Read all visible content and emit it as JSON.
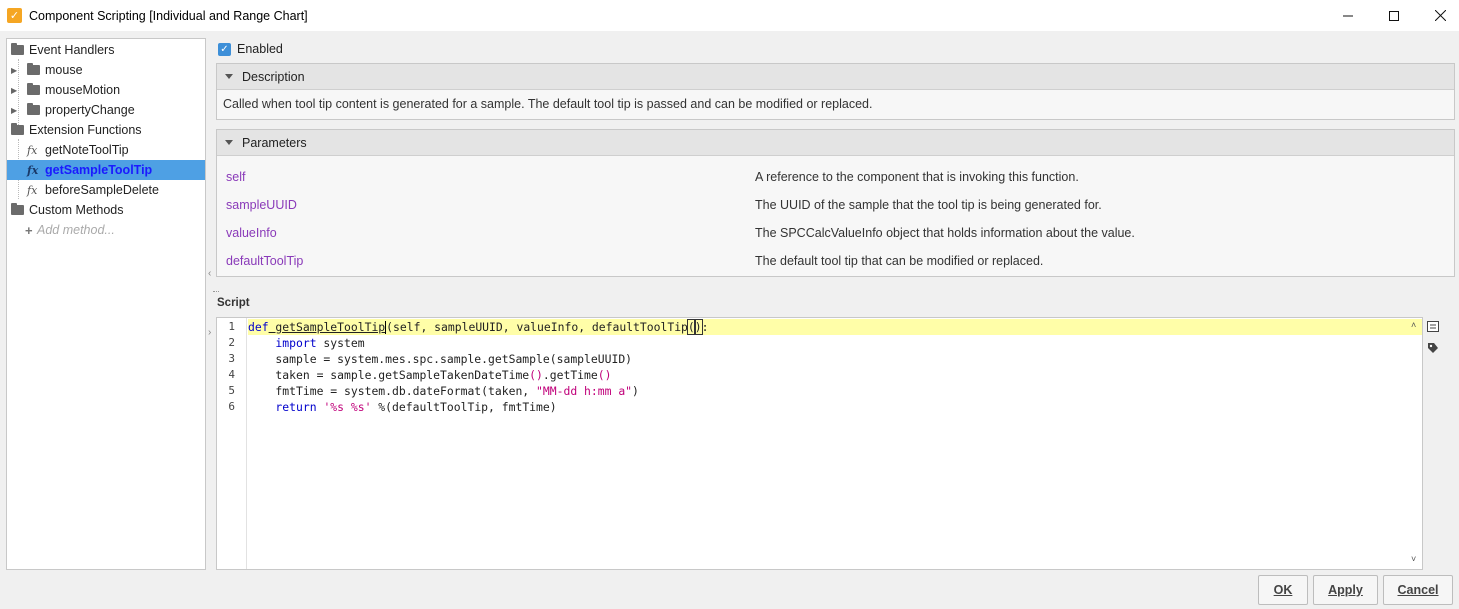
{
  "window": {
    "title": "Component Scripting [Individual and Range Chart]",
    "controls": [
      "minimize-icon",
      "maximize-icon",
      "close-icon"
    ]
  },
  "tree": {
    "event_handlers_label": "Event Handlers",
    "event_handlers": [
      "mouse",
      "mouseMotion",
      "propertyChange"
    ],
    "extension_functions_label": "Extension Functions",
    "extension_functions": [
      "getNoteToolTip",
      "getSampleToolTip",
      "beforeSampleDelete"
    ],
    "selected": "getSampleToolTip",
    "custom_methods_label": "Custom Methods",
    "add_method_label": "Add method..."
  },
  "enabled": {
    "label": "Enabled",
    "checked": true
  },
  "description": {
    "header": "Description",
    "text": "Called when tool tip content is generated for a sample. The default tool tip is passed and can be modified or replaced."
  },
  "parameters": {
    "header": "Parameters",
    "rows": [
      {
        "name": "self",
        "desc": "A reference to the component that is invoking this function."
      },
      {
        "name": "sampleUUID",
        "desc": "The UUID of the sample that the tool tip is being generated for."
      },
      {
        "name": "valueInfo",
        "desc": "The SPCCalcValueInfo object that holds information about the value."
      },
      {
        "name": "defaultToolTip",
        "desc": "The default tool tip that can be modified or replaced."
      }
    ]
  },
  "script": {
    "label": "Script",
    "line_numbers": [
      "1",
      "2",
      "3",
      "4",
      "5",
      "6"
    ],
    "lines": {
      "l1_kw": "def",
      "l1_name": " getSampleToolTip",
      "l1_args": "(self, sampleUUID, valueInfo, defaultToolTip",
      "l1_open": "(",
      "l1_close": ")",
      "l1_end": ":",
      "l2_kw": "    import",
      "l2_rest": " system",
      "l3": "    sample = system.mes.spc.sample.getSample(sampleUUID)",
      "l4_a": "    taken = sample.getSampleTakenDateTime",
      "l4_b": "()",
      "l4_c": ".getTime",
      "l4_d": "()",
      "l5_a": "    fmtTime = system.db.dateFormat(taken, ",
      "l5_str": "\"MM-dd h:mm a\"",
      "l5_b": ")",
      "l6_kw": "    return",
      "l6_sp": " ",
      "l6_str": "'%s %s'",
      "l6_rest": " %(defaultToolTip, fmtTime)"
    }
  },
  "buttons": {
    "ok": "OK",
    "apply": "Apply",
    "cancel": "Cancel"
  },
  "colors": {
    "accent": "#4ea0e4",
    "param_name": "#8a3ab9",
    "keyword": "#0000cc",
    "string": "#c0007a",
    "current_line": "#fffea8"
  }
}
